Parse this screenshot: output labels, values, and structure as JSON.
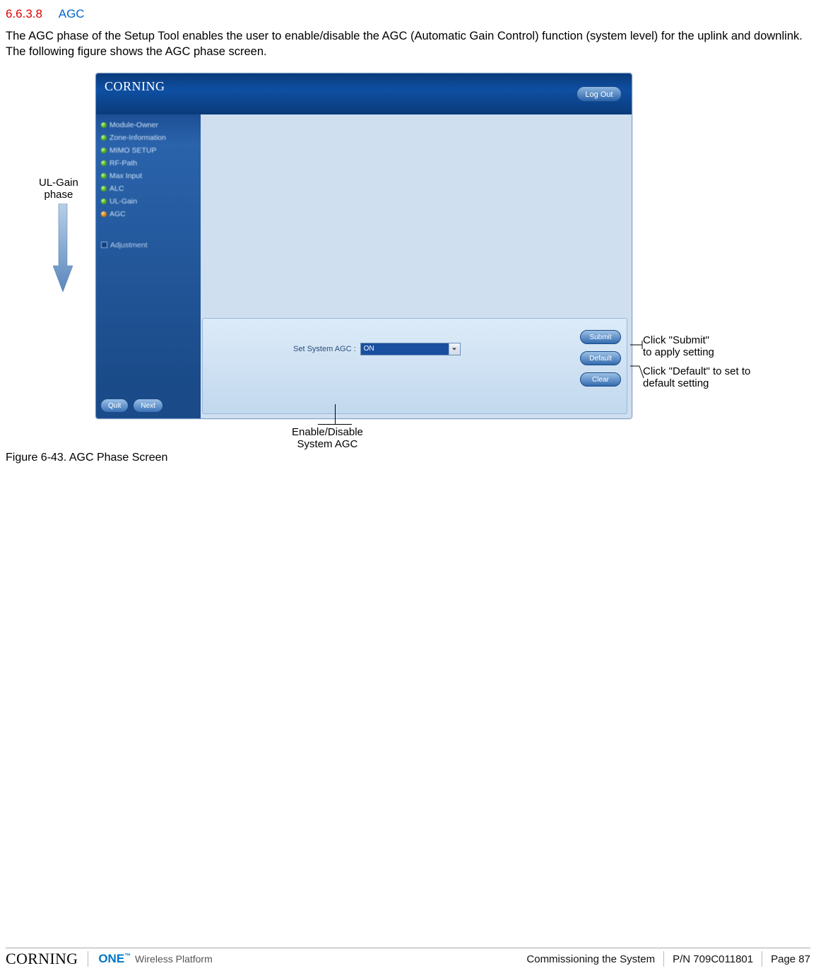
{
  "section": {
    "number": "6.6.3.8",
    "title": "AGC"
  },
  "intro": "The AGC phase of the Setup Tool enables the user to enable/disable the AGC (Automatic Gain Control) function (system level) for the uplink and downlink. The following figure shows the AGC phase screen.",
  "callouts": {
    "ulgain_line1": "UL-Gain",
    "ulgain_line2": "phase",
    "submit_line1": "Click \"Submit\"",
    "submit_line2": "to apply setting",
    "default_line1": "Click \"Default\" to set to",
    "default_line2": "default setting",
    "enable_line1": "Enable/Disable",
    "enable_line2": "System AGC"
  },
  "app": {
    "brand": "CORNING",
    "logout": "Log Out",
    "sidebar": {
      "items": [
        "Module-Owner",
        "Zone-Information",
        "MIMO SETUP",
        "RF-Path",
        "Max Input",
        "ALC",
        "UL-Gain",
        "AGC"
      ],
      "adjustment": "Adjustment",
      "quit": "Quit",
      "next": "Next"
    },
    "panel": {
      "field_label": "Set System AGC :",
      "select_value": "ON",
      "submit": "Submit",
      "default": "Default",
      "clear": "Clear"
    }
  },
  "figure_caption": "Figure 6-43. AGC Phase Screen",
  "footer": {
    "corning": "CORNING",
    "one": "ONE",
    "tm": "™",
    "sub": " Wireless Platform",
    "section": "Commissioning the System",
    "pn": "P/N 709C011801",
    "page": "Page 87"
  }
}
